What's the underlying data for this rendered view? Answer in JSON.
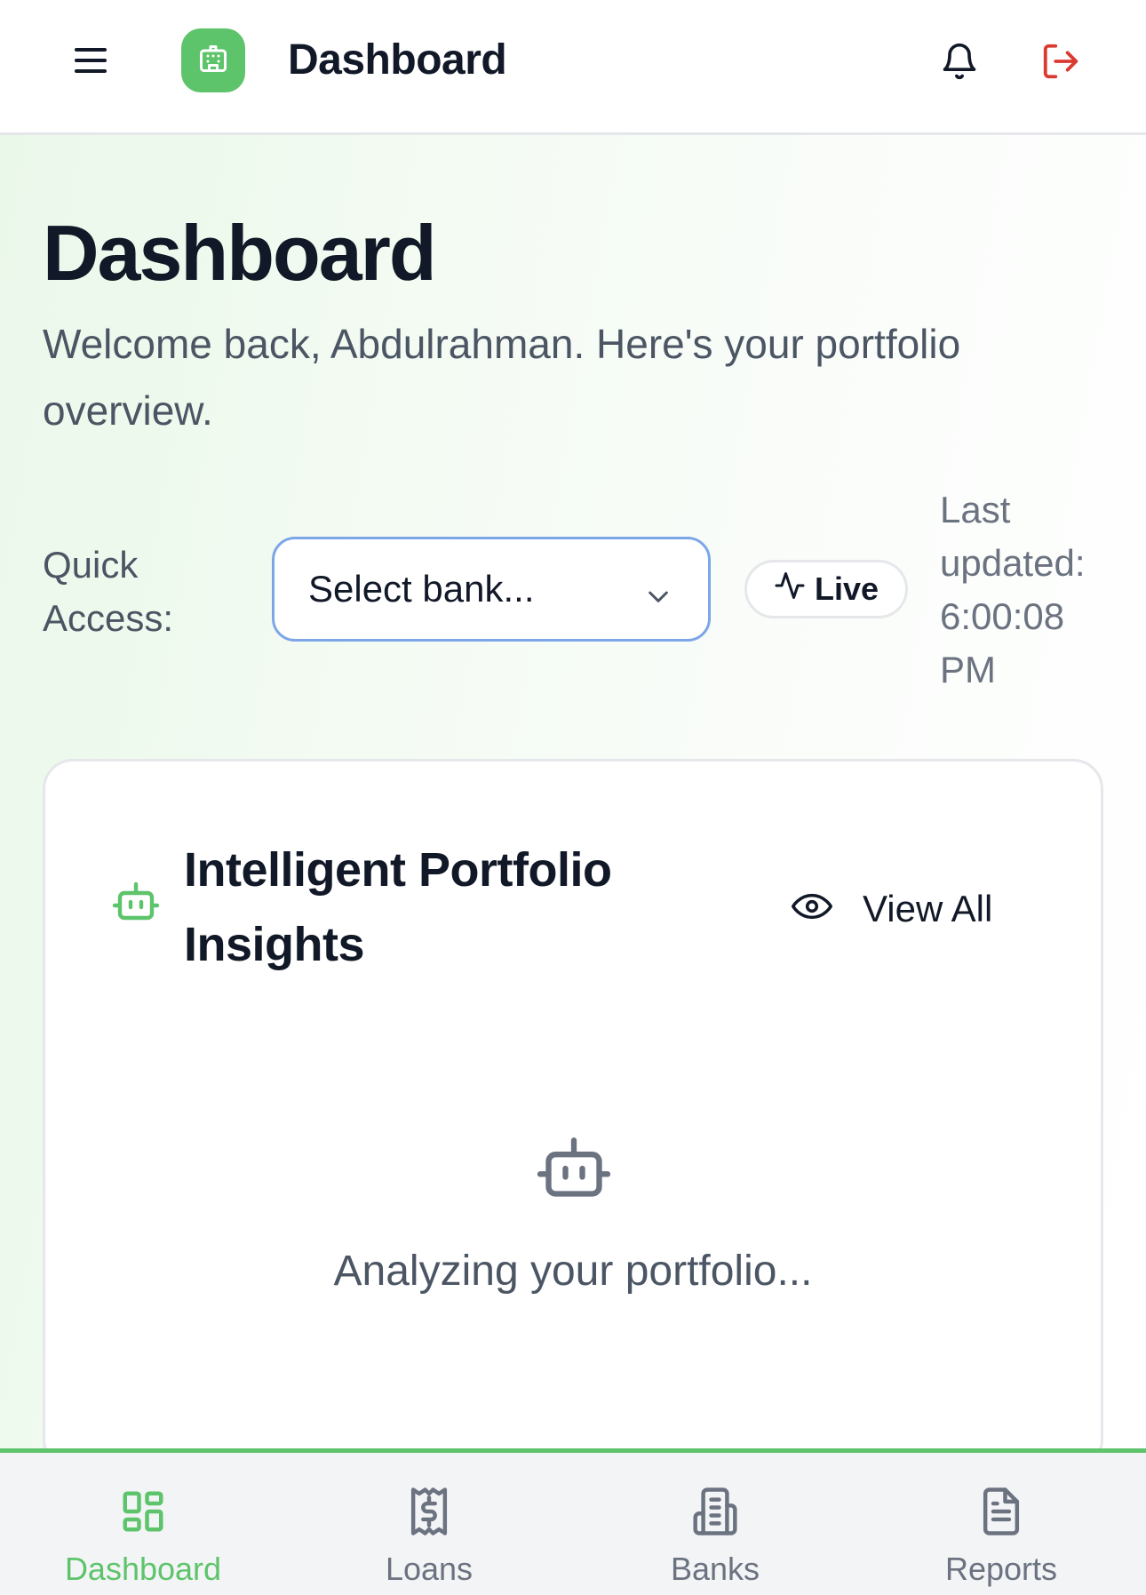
{
  "header": {
    "title": "Dashboard",
    "menu_icon": "menu-icon",
    "logo_icon": "building-icon",
    "bell_icon": "bell-icon",
    "logout_icon": "logout-icon",
    "accent_color": "#5ec46b",
    "logout_color": "#d93b30"
  },
  "main": {
    "title": "Dashboard",
    "welcome": "Welcome back, Abdulrahman. Here's your portfolio overview.",
    "quick_access_label": "Quick Access:",
    "bank_select": {
      "selected": "Select bank...",
      "icon": "chevron-down-icon"
    },
    "live_badge": {
      "label": "Live",
      "icon": "activity-icon"
    },
    "last_updated": "Last updated: 6:00:08 PM"
  },
  "insights_card": {
    "title": "Intelligent Portfolio Insights",
    "title_icon": "bot-icon",
    "view_all_label": "View All",
    "view_all_icon": "eye-icon",
    "empty_icon": "bot-icon",
    "empty_text": "Analyzing your portfolio..."
  },
  "bottom_nav": {
    "items": [
      {
        "label": "Dashboard",
        "icon": "dashboard-grid-icon",
        "active": true
      },
      {
        "label": "Loans",
        "icon": "receipt-dollar-icon",
        "active": false
      },
      {
        "label": "Banks",
        "icon": "bank-building-icon",
        "active": false
      },
      {
        "label": "Reports",
        "icon": "document-icon",
        "active": false
      }
    ]
  }
}
